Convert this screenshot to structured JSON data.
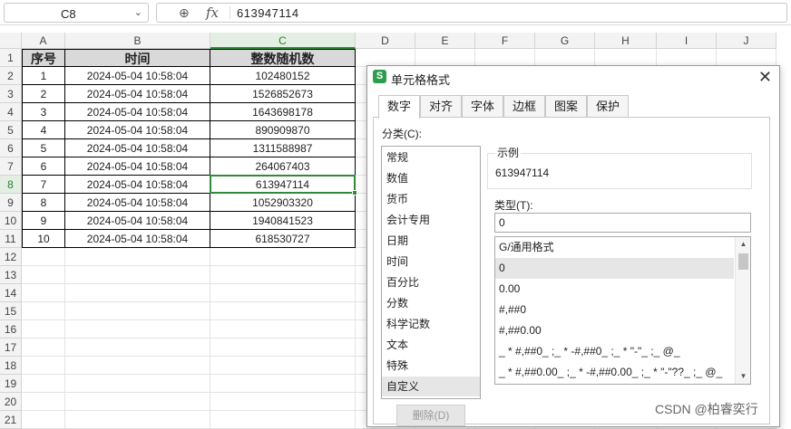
{
  "formula_bar": {
    "name_box": "C8",
    "zoom_icon": "zoom-icon",
    "fx_label": "fx",
    "value": "613947114"
  },
  "columns": [
    "A",
    "B",
    "C",
    "D",
    "E",
    "F",
    "G",
    "H",
    "I",
    "J"
  ],
  "rows": [
    "1",
    "2",
    "3",
    "4",
    "5",
    "6",
    "7",
    "8",
    "9",
    "10",
    "11",
    "12",
    "13",
    "14",
    "15",
    "16",
    "17",
    "18",
    "19",
    "20",
    "21"
  ],
  "table": {
    "headers": [
      "序号",
      "时间",
      "整数随机数"
    ],
    "rows": [
      [
        "1",
        "2024-05-04 10:58:04",
        "102480152"
      ],
      [
        "2",
        "2024-05-04 10:58:04",
        "1526852673"
      ],
      [
        "3",
        "2024-05-04 10:58:04",
        "1643698178"
      ],
      [
        "4",
        "2024-05-04 10:58:04",
        "890909870"
      ],
      [
        "5",
        "2024-05-04 10:58:04",
        "1311588987"
      ],
      [
        "6",
        "2024-05-04 10:58:04",
        "264067403"
      ],
      [
        "7",
        "2024-05-04 10:58:04",
        "613947114"
      ],
      [
        "8",
        "2024-05-04 10:58:04",
        "1052903320"
      ],
      [
        "9",
        "2024-05-04 10:58:04",
        "1940841523"
      ],
      [
        "10",
        "2024-05-04 10:58:04",
        "618530727"
      ]
    ]
  },
  "dialog": {
    "app_badge": "S",
    "title": "单元格格式",
    "tabs": [
      "数字",
      "对齐",
      "字体",
      "边框",
      "图案",
      "保护"
    ],
    "active_tab": "数字",
    "category_label": "分类(C):",
    "categories": [
      "常规",
      "数值",
      "货币",
      "会计专用",
      "日期",
      "时间",
      "百分比",
      "分数",
      "科学记数",
      "文本",
      "特殊",
      "自定义"
    ],
    "selected_category": "自定义",
    "sample_label": "示例",
    "sample_value": "613947114",
    "type_label": "类型(T):",
    "type_value": "0",
    "formats": [
      "G/通用格式",
      "0",
      "0.00",
      "#,##0",
      "#,##0.00",
      "_ * #,##0_ ;_ * -#,##0_ ;_ * \"-\"_ ;_ @_",
      "_ * #,##0.00_ ;_ * -#,##0.00_ ;_ * \"-\"??_ ;_ @_"
    ],
    "selected_format": "0",
    "delete_button": "删除(D)"
  },
  "watermark": "CSDN @柏睿奕行"
}
